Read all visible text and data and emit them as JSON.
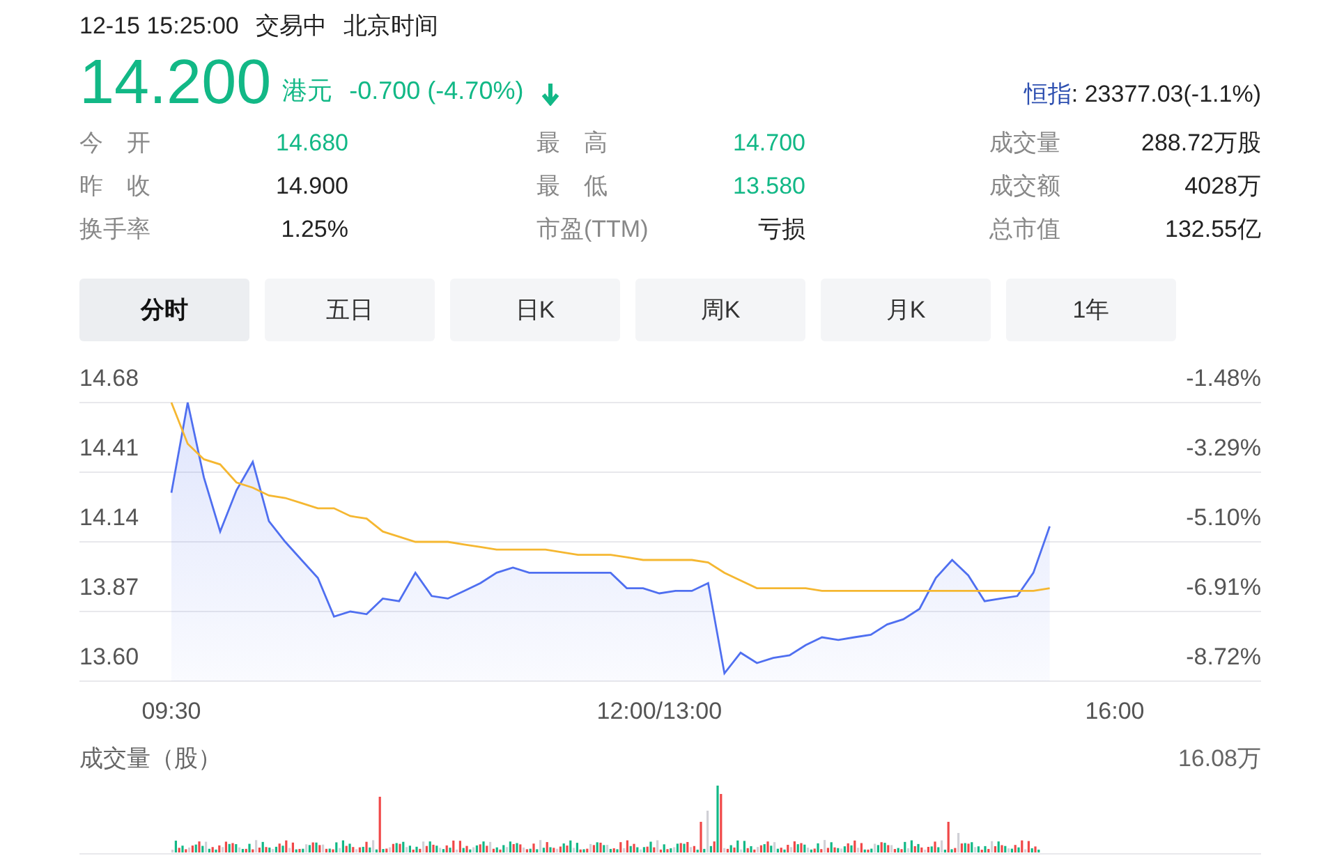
{
  "header": {
    "datetime": "12-15 15:25:00",
    "status": "交易中",
    "timezone": "北京时间"
  },
  "quote": {
    "price": "14.200",
    "currency": "港元",
    "change": "-0.700 (-4.70%)",
    "trend_down": true,
    "index": {
      "label": "恒指",
      "value": ": 23377.03(-1.1%)"
    }
  },
  "stats": [
    {
      "label": "今　开",
      "value": "14.680",
      "color": "#12b886"
    },
    {
      "label": "最　高",
      "value": "14.700",
      "color": "#12b886"
    },
    {
      "label": "成交量",
      "value": "288.72万股",
      "color": "#222222"
    },
    {
      "label": "昨　收",
      "value": "14.900",
      "color": "#222222"
    },
    {
      "label": "最　低",
      "value": "13.580",
      "color": "#12b886"
    },
    {
      "label": "成交额",
      "value": "4028万",
      "color": "#222222"
    },
    {
      "label": "换手率",
      "value": "1.25%",
      "color": "#222222"
    },
    {
      "label": "市盈(TTM)",
      "value": "亏损",
      "color": "#222222"
    },
    {
      "label": "总市值",
      "value": "132.55亿",
      "color": "#222222"
    }
  ],
  "tabs": [
    {
      "label": "分时",
      "selected": true
    },
    {
      "label": "五日",
      "selected": false
    },
    {
      "label": "日K",
      "selected": false
    },
    {
      "label": "周K",
      "selected": false
    },
    {
      "label": "月K",
      "selected": false
    },
    {
      "label": "1年",
      "selected": false
    }
  ],
  "intraday": {
    "percent_axis": [
      "-1.48%",
      "-3.29%",
      "-5.10%",
      "-6.91%",
      "-8.72%"
    ],
    "chart_data": {
      "type": "line",
      "grid": true,
      "categories": [
        "09:30",
        null,
        null,
        null,
        null,
        null,
        null,
        null,
        null,
        null,
        null,
        null,
        null,
        null,
        null,
        null,
        null,
        null,
        null,
        null,
        null,
        null,
        null,
        null,
        null,
        null,
        null,
        null,
        null,
        null,
        "12:00/13:00",
        null,
        null,
        null,
        null,
        null,
        null,
        null,
        null,
        null,
        null,
        null,
        null,
        null,
        null,
        null,
        null,
        null,
        null,
        null,
        null,
        null,
        null,
        null,
        null,
        null,
        null,
        null,
        "16:00"
      ],
      "series": [
        {
          "type": "area",
          "color": "#4f6ff0",
          "values": [
            14.33,
            14.68,
            14.39,
            14.18,
            14.34,
            14.45,
            14.22,
            14.14,
            14.07,
            14.0,
            13.85,
            13.87,
            13.86,
            13.92,
            13.91,
            14.02,
            13.93,
            13.92,
            13.95,
            13.98,
            14.02,
            14.04,
            14.02,
            14.02,
            14.02,
            14.02,
            14.02,
            14.02,
            13.96,
            13.96,
            13.94,
            13.95,
            13.95,
            13.98,
            13.63,
            13.71,
            13.67,
            13.69,
            13.7,
            13.74,
            13.77,
            13.76,
            13.77,
            13.78,
            13.82,
            13.84,
            13.88,
            14.0,
            14.07,
            14.01,
            13.91,
            13.92,
            13.93,
            14.02,
            14.2,
            null,
            null,
            null,
            null
          ]
        },
        {
          "type": "line",
          "color": "#f5b731",
          "values": [
            14.68,
            14.52,
            14.46,
            14.44,
            14.37,
            14.35,
            14.32,
            14.31,
            14.29,
            14.27,
            14.27,
            14.24,
            14.23,
            14.18,
            14.16,
            14.14,
            14.14,
            14.14,
            14.13,
            14.12,
            14.11,
            14.11,
            14.11,
            14.11,
            14.1,
            14.09,
            14.09,
            14.09,
            14.08,
            14.07,
            14.07,
            14.07,
            14.07,
            14.06,
            14.02,
            13.99,
            13.96,
            13.96,
            13.96,
            13.96,
            13.95,
            13.95,
            13.95,
            13.95,
            13.95,
            13.95,
            13.95,
            13.95,
            13.95,
            13.95,
            13.95,
            13.95,
            13.95,
            13.95,
            13.96,
            null,
            null,
            null,
            null
          ]
        }
      ],
      "ylim": [
        13.6,
        14.68
      ],
      "yticks": [
        14.68,
        14.41,
        14.14,
        13.87,
        {
          "value": 13.6,
          "label": "13.60"
        }
      ]
    }
  },
  "volume": {
    "title": "成交量（股）",
    "max_label": "16.08万"
  }
}
